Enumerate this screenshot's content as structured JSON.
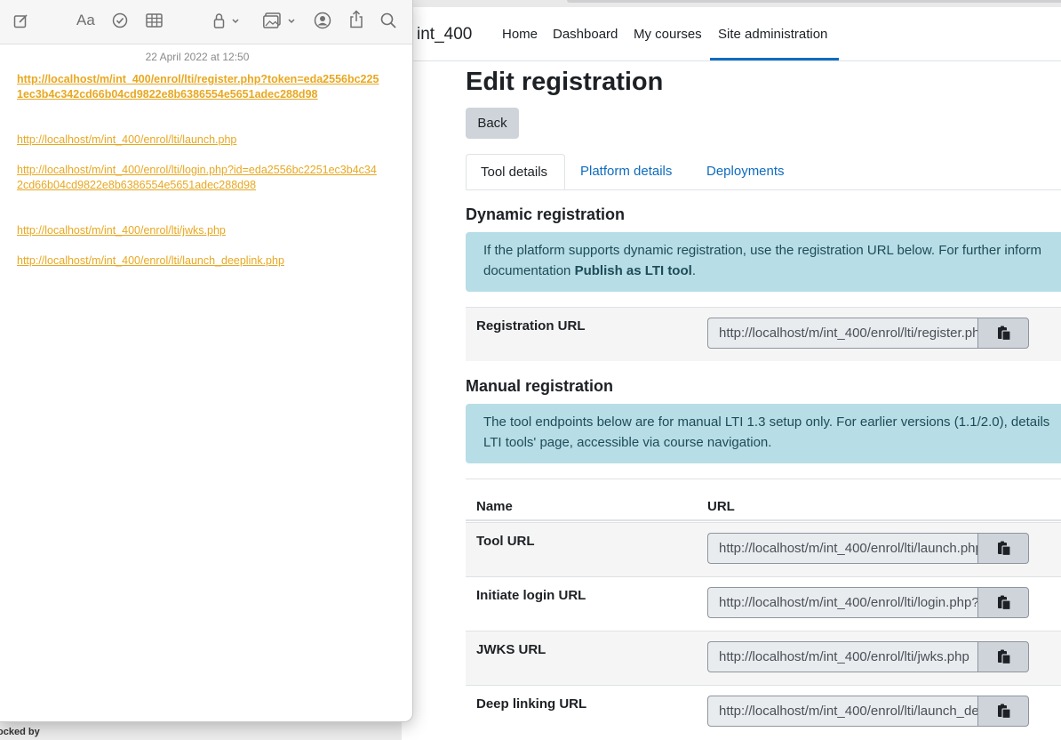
{
  "notes": {
    "date": "22 April 2022 at 12:50",
    "links": [
      "http://localhost/m/int_400/enrol/lti/register.php?token=eda2556bc2251ec3b4c342cd66b04cd9822e8b6386554e5651adec288d98",
      "http://localhost/m/int_400/enrol/lti/launch.php",
      "http://localhost/m/int_400/enrol/lti/login.php?id=eda2556bc2251ec3b4c342cd66b04cd9822e8b6386554e5651adec288d98",
      "http://localhost/m/int_400/enrol/lti/jwks.php",
      "http://localhost/m/int_400/enrol/lti/launch_deeplink.php"
    ],
    "toolbar_icons": [
      "compose-icon",
      "text-format-icon",
      "checklist-icon",
      "table-icon",
      "lock-icon",
      "media-icon",
      "collaborate-icon",
      "share-icon",
      "search-icon"
    ]
  },
  "status_bar": {
    "text": "ocked by"
  },
  "site": {
    "name": "int_400",
    "nav": [
      "Home",
      "Dashboard",
      "My courses",
      "Site administration"
    ],
    "active_nav": "Site administration"
  },
  "page": {
    "title": "Edit registration",
    "back_label": "Back",
    "tabs": [
      "Tool details",
      "Platform details",
      "Deployments"
    ],
    "active_tab": "Tool details"
  },
  "dynamic": {
    "heading": "Dynamic registration",
    "alert_text": "If the platform supports dynamic registration, use the registration URL below. For further inform",
    "alert_text2": "documentation ",
    "alert_bold": "Publish as LTI tool",
    "alert_end": ".",
    "registration_label": "Registration URL",
    "registration_value": "http://localhost/m/int_400/enrol/lti/register.php?token=eda2556bc2251ec3b4c342cd66b04cd9822e8b6386554e5651adec288d98"
  },
  "manual": {
    "heading": "Manual registration",
    "alert_line1": "The tool endpoints below are for manual LTI 1.3 setup only. For earlier versions (1.1/2.0), details",
    "alert_line2": "LTI tools' page, accessible via course navigation.",
    "col_name": "Name",
    "col_url": "URL",
    "rows": [
      {
        "label": "Tool URL",
        "value": "http://localhost/m/int_400/enrol/lti/launch.php"
      },
      {
        "label": "Initiate login URL",
        "value": "http://localhost/m/int_400/enrol/lti/login.php?id=eda2556bc2251ec3b4c342cd66b04cd9822e8b6386554e5651adec288d98"
      },
      {
        "label": "JWKS URL",
        "value": "http://localhost/m/int_400/enrol/lti/jwks.php"
      },
      {
        "label": "Deep linking URL",
        "value": "http://localhost/m/int_400/enrol/lti/launch_deeplink.php"
      }
    ]
  },
  "colors": {
    "link": "#0f6cbf",
    "alert_bg": "#b7dde6",
    "notes_link": "#e8a821"
  }
}
